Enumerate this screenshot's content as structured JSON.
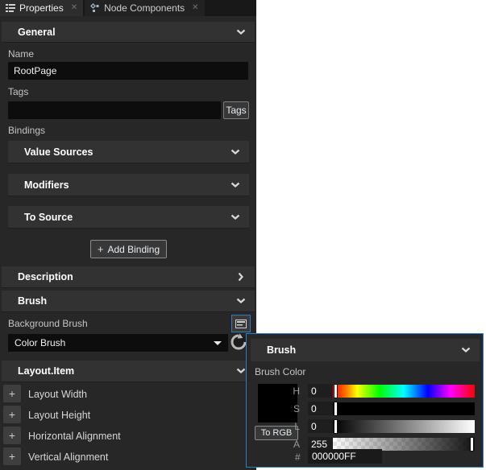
{
  "tab_bar": {
    "tabs": [
      {
        "label": "Properties"
      },
      {
        "label": "Node Components"
      }
    ],
    "close_glyph": "✕"
  },
  "panel": {
    "plus_glyph": "+",
    "general": {
      "header": "General",
      "name_label": "Name",
      "name_value": "RootPage",
      "tags_label": "Tags",
      "tags_value": "",
      "tags_button": "Tags",
      "bindings_label": "Bindings",
      "binding_sections": [
        {
          "label": "Value Sources"
        },
        {
          "label": "Modifiers"
        },
        {
          "label": "To Source"
        }
      ],
      "add_binding_button": "Add Binding"
    },
    "description": {
      "header": "Description"
    },
    "brush": {
      "header": "Brush",
      "background_brush_label": "Background Brush",
      "brush_type_selected": "Color Brush"
    },
    "layout_item": {
      "header": "Layout.Item",
      "rows": [
        {
          "label": "Layout Width"
        },
        {
          "label": "Layout Height"
        },
        {
          "label": "Horizontal Alignment"
        },
        {
          "label": "Vertical Alignment"
        }
      ]
    }
  },
  "popup": {
    "header": "Brush",
    "color_label": "Brush Color",
    "swatch_color": "#000000",
    "to_rgb_button": "To RGB",
    "sliders": [
      {
        "label": "H",
        "value": "0"
      },
      {
        "label": "S",
        "value": "0"
      },
      {
        "label": "L",
        "value": "0"
      },
      {
        "label": "A",
        "value": "255"
      }
    ],
    "hex_label": "#",
    "hex_value": "000000FF"
  },
  "colors": {
    "accent_blue": "#2b7ec2",
    "panel_bg": "#272727",
    "header_bg": "#323232",
    "input_bg": "#0d0d0d"
  }
}
